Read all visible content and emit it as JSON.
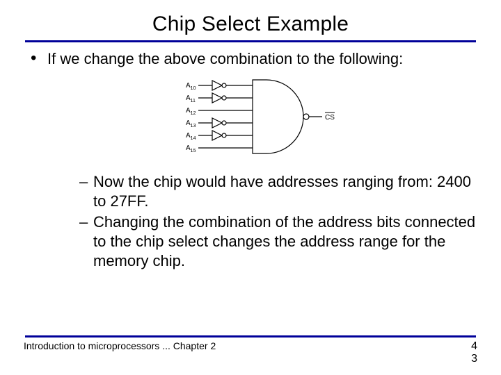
{
  "title": "Chip Select Example",
  "bullet": "If we change the above combination to the following:",
  "sub_bullets": [
    "Now the chip would have addresses ranging from: 2400 to 27FF.",
    "Changing the combination of the address bits connected to the chip select changes the address range for the memory chip."
  ],
  "diagram": {
    "inputs": [
      "A10",
      "A11",
      "A12",
      "A13",
      "A14",
      "A15"
    ],
    "inverted_lines": [
      0,
      1,
      3,
      4
    ],
    "output_label": "CS",
    "output_overbar": true
  },
  "footer_left": "Introduction to microprocessors ... Chapter 2",
  "page_numbers": [
    "4",
    "3"
  ]
}
